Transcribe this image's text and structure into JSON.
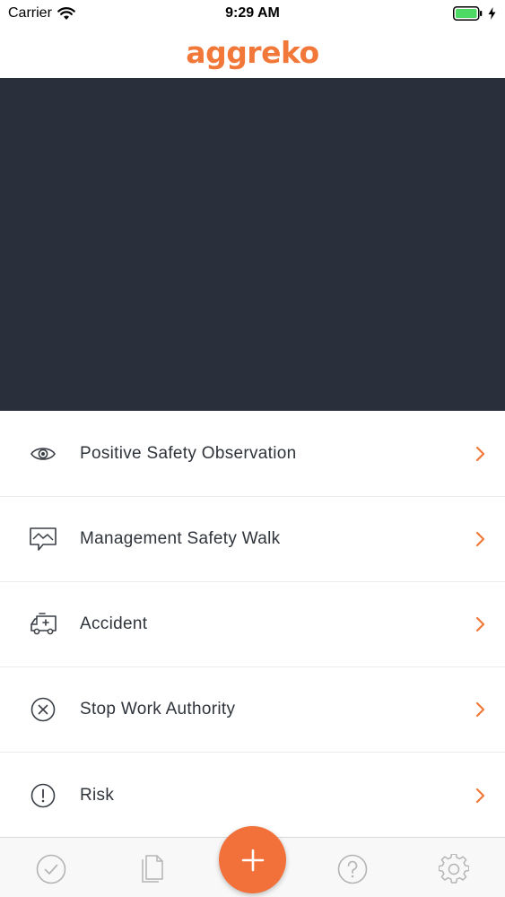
{
  "status_bar": {
    "carrier": "Carrier",
    "time": "9:29 AM"
  },
  "header": {
    "logo_text": "aggreko"
  },
  "menu": {
    "items": [
      {
        "label": "Positive Safety Observation",
        "icon": "eye-icon"
      },
      {
        "label": "Management Safety Walk",
        "icon": "chat-map-icon"
      },
      {
        "label": "Accident",
        "icon": "ambulance-icon"
      },
      {
        "label": "Stop Work Authority",
        "icon": "circle-x-icon"
      },
      {
        "label": "Risk",
        "icon": "circle-exclamation-icon"
      }
    ]
  },
  "tab_bar": {
    "items": [
      "check-circle-icon",
      "documents-icon",
      "plus-icon",
      "help-circle-icon",
      "gear-icon"
    ]
  },
  "colors": {
    "accent": "#f2783a",
    "hero_background": "#2a303b",
    "text": "#2f343b",
    "icon_grey": "#b4b4b4"
  }
}
